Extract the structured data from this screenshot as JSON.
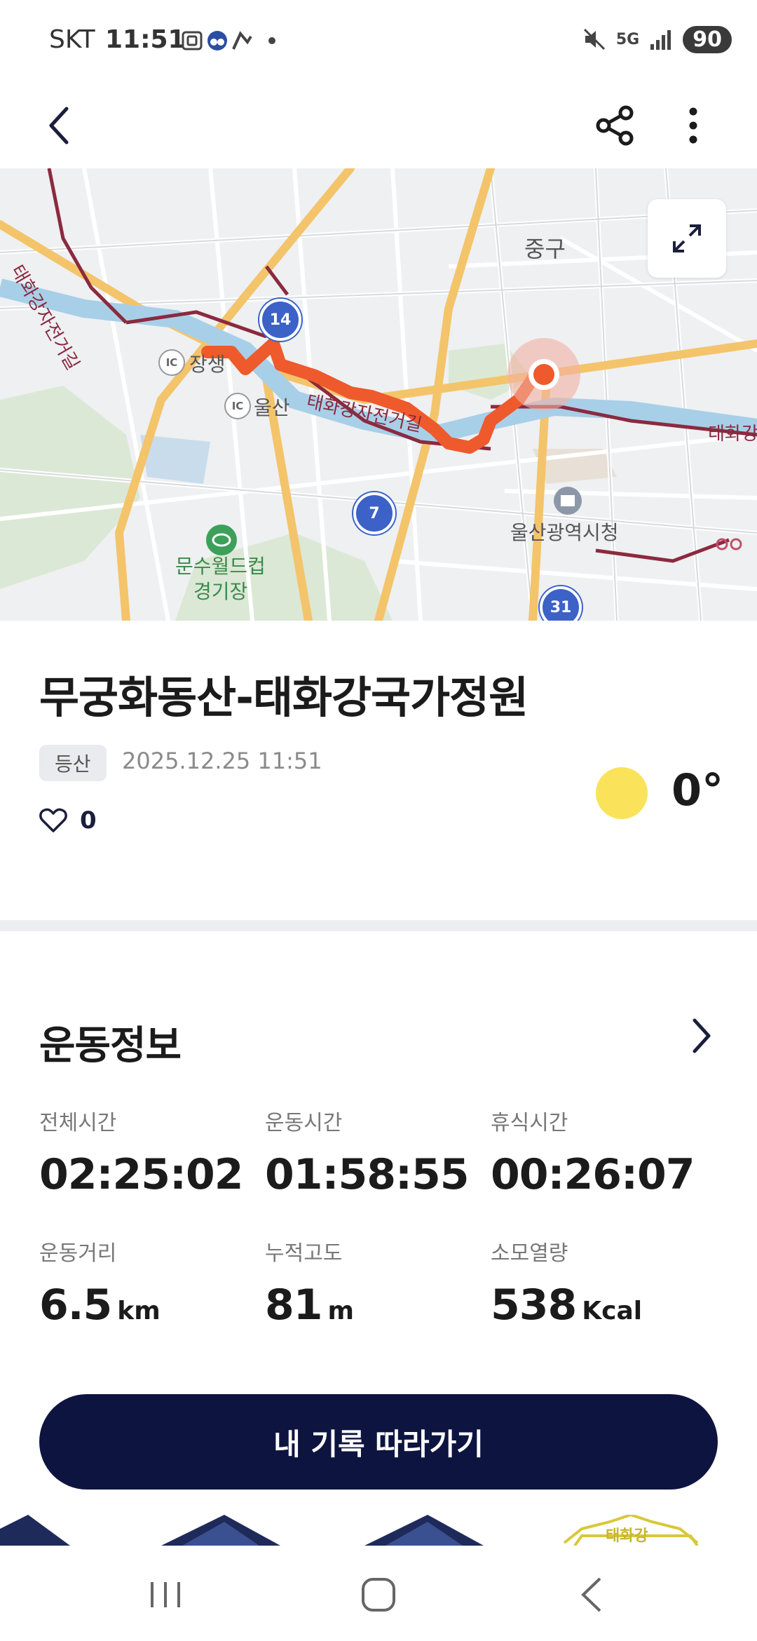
{
  "status_bar": {
    "carrier": "SKT",
    "time": "11:51",
    "network": "5G",
    "battery": "90"
  },
  "map": {
    "labels": {
      "junggu": "중구",
      "jangseng": "장생",
      "ulsan": "울산",
      "munsu_line1": "문수월드컵",
      "munsu_line2": "경기장",
      "city_hall": "울산광역시청",
      "ic1": "IC",
      "ic2": "IC"
    },
    "road_labels": {
      "taehwa_bike_top": "태화강자전거길",
      "taehwa_bike_mid": "태화강자전거길",
      "taehwa_right": "태화강"
    },
    "route_badges": {
      "r14": "14",
      "r7": "7",
      "r31": "31"
    },
    "colors": {
      "route": "#ee5a2c",
      "water": "#a8cfe8",
      "bike_road": "#8b2a3f",
      "major_road": "#f4c46b"
    }
  },
  "activity": {
    "title": "무궁화동산-태화강국가정원",
    "tag": "등산",
    "datetime": "2025.12.25 11:51",
    "likes": "0",
    "weather_temp": "0°"
  },
  "exercise_info": {
    "title": "운동정보",
    "stats": [
      {
        "label": "전체시간",
        "value": "02:25:02",
        "unit": ""
      },
      {
        "label": "운동시간",
        "value": "01:58:55",
        "unit": ""
      },
      {
        "label": "휴식시간",
        "value": "00:26:07",
        "unit": ""
      },
      {
        "label": "운동거리",
        "value": "6.5",
        "unit": "km"
      },
      {
        "label": "누적고도",
        "value": "81",
        "unit": "m"
      },
      {
        "label": "소모열량",
        "value": "538",
        "unit": "Kcal"
      }
    ]
  },
  "cta": {
    "label": "내 기록 따라가기"
  },
  "banner": {
    "text": "태화강"
  },
  "icons": {
    "back": "chevron-left-icon",
    "share": "share-icon",
    "more": "more-vertical-icon",
    "expand": "expand-icon",
    "heart": "heart-outline-icon",
    "weather": "sun-icon"
  }
}
